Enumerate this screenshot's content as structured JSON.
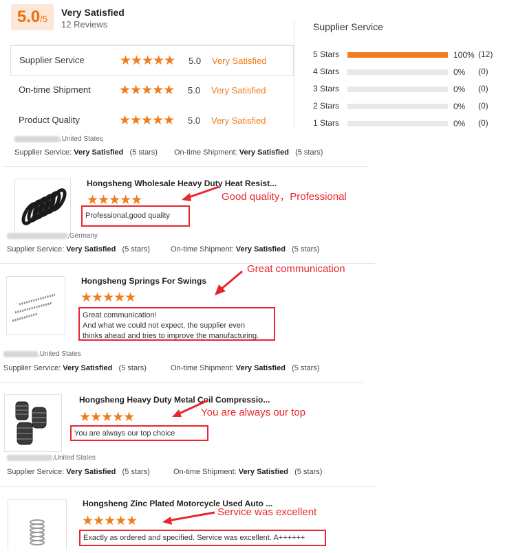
{
  "summary": {
    "score": "5.0",
    "score_max": "/5",
    "title": "Very Satisfied",
    "reviews": "12 Reviews"
  },
  "ratings": [
    {
      "label": "Supplier Service",
      "stars": "★★★★★",
      "score": "5.0",
      "text": "Very Satisfied"
    },
    {
      "label": "On-time Shipment",
      "stars": "★★★★★",
      "score": "5.0",
      "text": "Very Satisfied"
    },
    {
      "label": "Product Quality",
      "stars": "★★★★★",
      "score": "5.0",
      "text": "Very Satisfied"
    }
  ],
  "supplier_service": {
    "title": "Supplier Service",
    "bars": [
      {
        "label": "5 Stars",
        "fraction": 1.0,
        "pct": "100%",
        "count": "(12)"
      },
      {
        "label": "4 Stars",
        "fraction": 0.0,
        "pct": "0%",
        "count": "(0)"
      },
      {
        "label": "3 Stars",
        "fraction": 0.0,
        "pct": "0%",
        "count": "(0)"
      },
      {
        "label": "2 Stars",
        "fraction": 0.0,
        "pct": "0%",
        "count": "(0)"
      },
      {
        "label": "1 Stars",
        "fraction": 0.0,
        "pct": "0%",
        "count": "(0)"
      }
    ]
  },
  "reviews": [
    {
      "country": ",United States",
      "svc_label": "Supplier Service:",
      "svc_value": "Very Satisfied",
      "svc_stars": "(5 stars)",
      "ship_label": "On-time Shipment:",
      "ship_value": "Very Satisfied",
      "ship_stars": "(5 stars)"
    },
    {
      "product": "Hongsheng Wholesale Heavy Duty Heat Resist...",
      "stars": "★★★★★",
      "comment": "Professional,good quality",
      "annotation": "Good quality，Professional",
      "country": ",Germany",
      "svc_label": "Supplier Service:",
      "svc_value": "Very Satisfied",
      "svc_stars": "(5 stars)",
      "ship_label": "On-time Shipment:",
      "ship_value": "Very Satisfied",
      "ship_stars": "(5 stars)"
    },
    {
      "product": "Hongsheng Springs For Swings",
      "stars": "★★★★★",
      "comment_lines": [
        "Great communication!",
        "And what we could not expect, the supplier even",
        "thinks ahead and tries to improve the manufacturing."
      ],
      "annotation": "Great communication",
      "country": ",United States",
      "svc_label": "Supplier Service:",
      "svc_value": "Very Satisfied",
      "svc_stars": "(5 stars)",
      "ship_label": "On-time Shipment:",
      "ship_value": "Very Satisfied",
      "ship_stars": "(5 stars)"
    },
    {
      "product": "Hongsheng Heavy Duty Metal Coil Compressio...",
      "stars": "★★★★★",
      "comment": "You are always our top choice",
      "annotation": "You are always our top",
      "country": ",United States",
      "svc_label": "Supplier Service:",
      "svc_value": "Very Satisfied",
      "svc_stars": "(5 stars)",
      "ship_label": "On-time Shipment:",
      "ship_value": "Very Satisfied",
      "ship_stars": "(5 stars)"
    },
    {
      "product": "Hongsheng Zinc Plated Motorcycle Used Auto ...",
      "stars": "★★★★★",
      "comment": "Exactly as ordered and specified.  Service was excellent.  A++++++",
      "annotation": "Service was excellent"
    }
  ],
  "colors": {
    "accent": "#f07c1b",
    "annotation_red": "#e8262e",
    "score_bg": "#fde7d8"
  }
}
